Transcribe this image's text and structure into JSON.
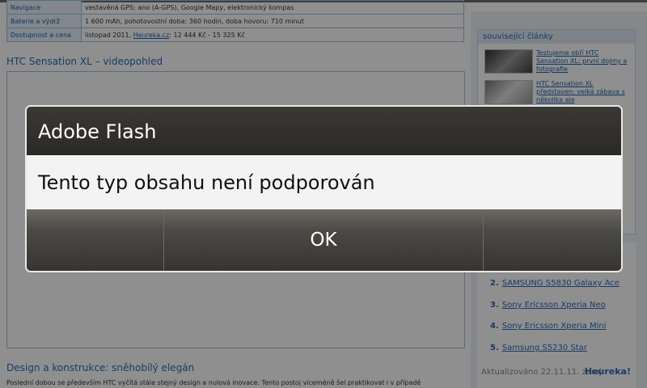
{
  "page": {
    "spec_rows": [
      {
        "key": "Navigace",
        "value": "vestavěná GPS: ano (A-GPS), Google Mapy, elektronický kompas"
      },
      {
        "key": "Baterie a výdrž",
        "value": "1 600 mAh, pohotovostní doba: 360 hodin, doba hovoru: 710 minut"
      },
      {
        "key": "Dostupnost a cena",
        "value_prefix": "listopad 2011, ",
        "value_link": "Heureka.cz",
        "value_suffix": ": 12 444 Kč - 15 325 Kč"
      }
    ],
    "video_section_title": "HTC Sensation XL – videopohled",
    "design_section_title": "Design a konstrukce: sněhobílý elegán",
    "design_text": "Poslední dobou se především HTC vyčítá stále stejný design a nulová inovace. Tento postoj víceméně šel praktikovat i v případě",
    "sidebar": {
      "related_heading": "související články",
      "related_items": [
        {
          "title": "Testujeme obří HTC Sensation XL: první dojmy a fotografie"
        },
        {
          "title": "HTC Sensation XL představen: velká zábava s několika ale"
        }
      ],
      "ranking": [
        {
          "rank": "2.",
          "name": "SAMSUNG S5830 Galaxy Ace"
        },
        {
          "rank": "3.",
          "name": "Sony Ericsson Xperia Neo"
        },
        {
          "rank": "4.",
          "name": "Sony Ericsson Xperia Mini"
        },
        {
          "rank": "5.",
          "name": "Samsung S5230 Star"
        }
      ],
      "updated": "Aktualizováno 22.11.11. zdroj",
      "source_logo": "Heureka!"
    }
  },
  "dialog": {
    "title": "Adobe Flash",
    "message": "Tento typ obsahu není podporován",
    "ok_label": "OK"
  },
  "colors": {
    "dialog_title_bg": "#2f2e2b",
    "dialog_message_bg": "#f3f3f3",
    "link_blue": "#2a6db5"
  }
}
